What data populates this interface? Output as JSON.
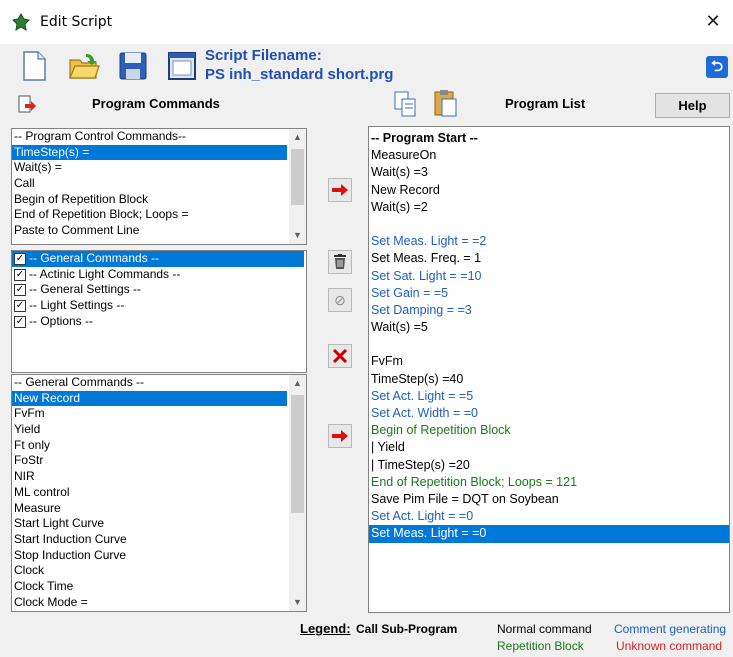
{
  "window": {
    "title": "Edit Script",
    "close": "✕"
  },
  "toolbar": {
    "filename_label": "Script Filename:",
    "filename_value": "PS inh_standard short.prg",
    "program_commands_label": "Program Commands",
    "program_list_label": "Program List",
    "help_label": "Help"
  },
  "control_commands": {
    "items": [
      "-- Program Control Commands--",
      "TimeStep(s) =",
      "Wait(s) =",
      "Call",
      "Begin of Repetition Block",
      "End of Repetition Block; Loops =",
      "Paste to Comment Line"
    ],
    "selected_index": 1
  },
  "categories": {
    "items": [
      "-- General Commands --",
      "-- Actinic Light Commands --",
      "-- General Settings --",
      "-- Light Settings --",
      "-- Options --"
    ],
    "selected_index": 0
  },
  "general_commands": {
    "items": [
      "-- General Commands --",
      "New Record",
      "FvFm",
      "Yield",
      "Ft only",
      "FoStr",
      "NIR",
      "ML control",
      "Measure",
      "Start Light Curve",
      "Start Induction Curve",
      "Stop Induction Curve",
      "Clock",
      "Clock Time",
      "Clock Mode ="
    ],
    "selected_index": 1
  },
  "program_list": {
    "items": [
      {
        "text": "-- Program Start --",
        "type": "bold"
      },
      {
        "text": "MeasureOn",
        "type": "normal"
      },
      {
        "text": "Wait(s) =3",
        "type": "normal"
      },
      {
        "text": "New Record",
        "type": "normal"
      },
      {
        "text": "Wait(s) =2",
        "type": "normal"
      },
      {
        "text": "",
        "type": "normal"
      },
      {
        "text": "Set Meas. Light = =2",
        "type": "comment"
      },
      {
        "text": "Set Meas. Freq. = 1",
        "type": "normal"
      },
      {
        "text": "Set Sat. Light = =10",
        "type": "comment"
      },
      {
        "text": "Set Gain = =5",
        "type": "comment"
      },
      {
        "text": "Set Damping = =3",
        "type": "comment"
      },
      {
        "text": "Wait(s) =5",
        "type": "normal"
      },
      {
        "text": "",
        "type": "normal"
      },
      {
        "text": "FvFm",
        "type": "normal"
      },
      {
        "text": "TimeStep(s) =40",
        "type": "normal"
      },
      {
        "text": "Set Act. Light = =5",
        "type": "comment"
      },
      {
        "text": "Set Act. Width = =0",
        "type": "comment"
      },
      {
        "text": "Begin of Repetition Block",
        "type": "block"
      },
      {
        "text": "| Yield",
        "type": "normal"
      },
      {
        "text": "| TimeStep(s) =20",
        "type": "normal"
      },
      {
        "text": "End of Repetition Block; Loops = 121",
        "type": "block"
      },
      {
        "text": "Save Pim File = DQT on Soybean",
        "type": "normal"
      },
      {
        "text": "Set Act. Light = =0",
        "type": "comment"
      },
      {
        "text": "Set Meas. Light = =0",
        "type": "selected"
      }
    ]
  },
  "legend": {
    "label": "Legend:",
    "call_sub": "Call Sub-Program",
    "normal": "Normal command",
    "comment": "Comment generating",
    "repetition": "Repetition Block",
    "unknown": "Unknown command"
  },
  "colors": {
    "selection": "#0078d7",
    "comment": "#1f5fbf",
    "block": "#1a7a1a",
    "unknown": "#e02020",
    "filename": "#1f4fb4"
  }
}
